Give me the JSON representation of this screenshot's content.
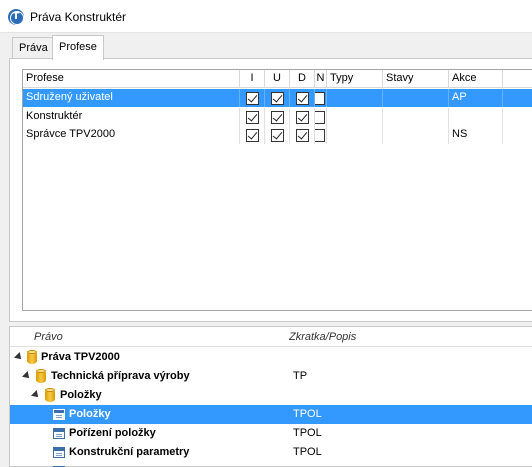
{
  "window": {
    "title": "Práva Konstruktér"
  },
  "tabs": [
    {
      "label": "Práva",
      "active": false
    },
    {
      "label": "Profese",
      "active": true
    }
  ],
  "grid": {
    "columns": [
      "Profese",
      "I",
      "U",
      "D",
      "N",
      "Typy",
      "Stavy",
      "Akce"
    ],
    "rows": [
      {
        "profese": "Sdružený uživatel",
        "I": true,
        "U": true,
        "D": true,
        "N": false,
        "typy": "",
        "stavy": "",
        "akce": "AP",
        "selected": true
      },
      {
        "profese": "Konstruktér",
        "I": true,
        "U": true,
        "D": true,
        "N": false,
        "typy": "",
        "stavy": "",
        "akce": "",
        "selected": false
      },
      {
        "profese": "Správce TPV2000",
        "I": true,
        "U": true,
        "D": true,
        "N": false,
        "typy": "",
        "stavy": "",
        "akce": "NS",
        "selected": false
      }
    ]
  },
  "tree": {
    "columns": {
      "pravo": "Právo",
      "zkratka": "Zkratka/Popis"
    },
    "rows": [
      {
        "label": "Práva TPV2000",
        "abbr": "",
        "icon": "database-icon",
        "level": 0
      },
      {
        "label": "Technická příprava výroby",
        "abbr": "TP",
        "icon": "database-icon",
        "level": 1
      },
      {
        "label": "Položky",
        "abbr": "",
        "icon": "database-icon",
        "level": 2
      },
      {
        "label": "Položky",
        "abbr": "TPOL",
        "icon": "form-icon",
        "level": 3,
        "selected": true
      },
      {
        "label": "Pořízení položky",
        "abbr": "TPOL",
        "icon": "form-icon",
        "level": 3
      },
      {
        "label": "Konstrukční parametry",
        "abbr": "TPOL",
        "icon": "form-icon",
        "level": 3
      }
    ]
  },
  "colors": {
    "selection": "#3399ff",
    "window_bg": "#f0f0f0",
    "icon_blue": "#2b6cb8"
  }
}
